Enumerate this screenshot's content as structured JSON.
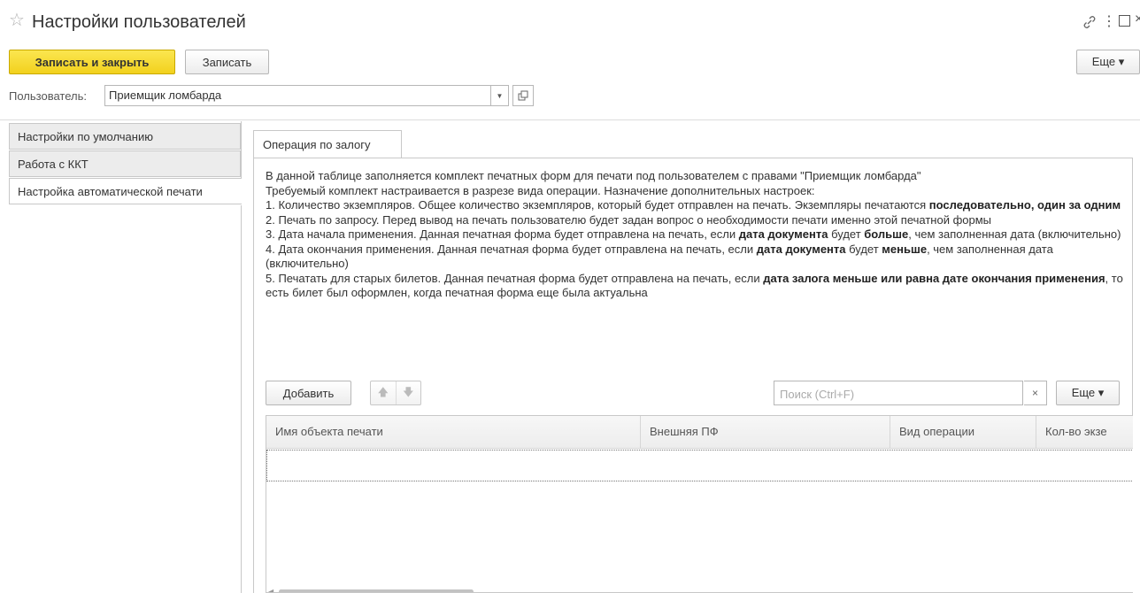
{
  "window": {
    "title": "Настройки пользователей",
    "icons": [
      "star-icon",
      "link-icon",
      "more-vertical-icon",
      "maximize-icon",
      "close-icon"
    ]
  },
  "toolbar": {
    "save_close_label": "Записать и закрыть",
    "save_label": "Записать",
    "more_label": "Еще ▾"
  },
  "user": {
    "label": "Пользователь:",
    "value": "Приемщик ломбарда"
  },
  "sidebar": {
    "tabs": [
      {
        "label": "Настройки по умолчанию"
      },
      {
        "label": "Работа с ККТ"
      },
      {
        "label": "Настройка автоматической печати"
      }
    ],
    "active_index": 2
  },
  "panel": {
    "tab_label": "Операция по залогу",
    "desc": {
      "l1": "В данной таблице заполняется комплект печатных форм для печати под пользователем с правами \"Приемщик ломбарда\"",
      "l2": "Требуемый комплект настраивается в разрезе вида операции. Назначение дополнительных настроек:",
      "l3": "1. Количество экземпляров. Общее количество экземпляров, который будет отправлен на печать. Экземпляры печатаются ",
      "l3b": "последовательно, один за одним",
      "l4": "2. Печать по запросу. Перед вывод на печать пользователю будет задан вопрос о необходимости печати именно этой печатной формы",
      "l5a": "3. Дата начала применения. Данная печатная форма будет отправлена на печать, если ",
      "l5b": "дата документа",
      "l5c": " будет ",
      "l5d": "больше",
      "l5e": ", чем заполненная дата (включительно)",
      "l6a": "4. Дата окончания применения. Данная печатная форма будет отправлена на печать, если ",
      "l6b": "дата документа",
      "l6c": " будет ",
      "l6d": "меньше",
      "l6e": ", чем заполненная дата (включительно)",
      "l7a": "5. Печатать для старых билетов. Данная печатная форма будет отправлена на печать, если ",
      "l7b": "дата залога меньше или равна дате окончания применения",
      "l7c": ", то есть билет был оформлен, когда печатная форма еще была актуальна"
    }
  },
  "table_toolbar": {
    "add_label": "Добавить",
    "search_placeholder": "Поиск (Ctrl+F)",
    "clear_label": "×",
    "more_label": "Еще ▾"
  },
  "table": {
    "columns": [
      "Имя объекта печати",
      "Внешняя ПФ",
      "Вид операции",
      "Кол-во экзе"
    ],
    "rows": []
  }
}
